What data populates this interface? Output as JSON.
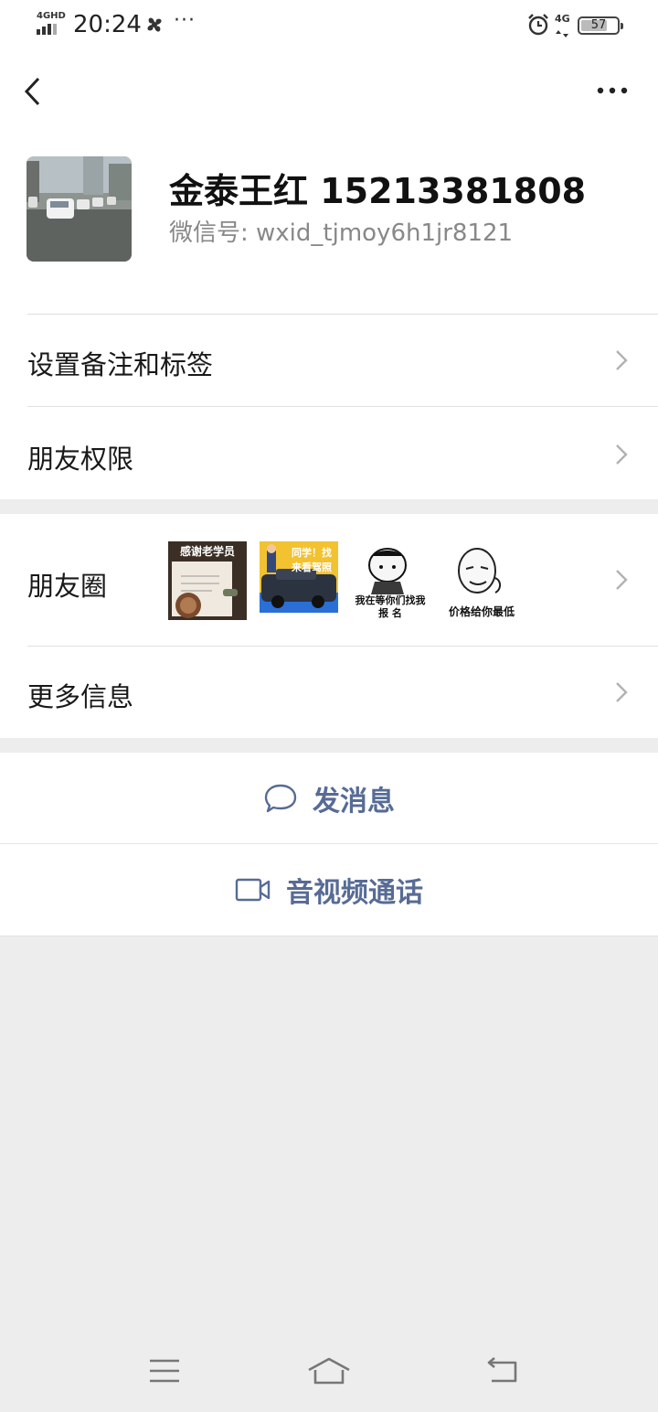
{
  "status_bar": {
    "network_label": "4GHD",
    "time": "20:24",
    "more_dots": "···",
    "mobile_label": "4G",
    "battery_level": "57"
  },
  "profile": {
    "name": "金泰王红 15213381808",
    "wechat_id": "微信号:  wxid_tjmoy6h1jr8121"
  },
  "menu": {
    "remark_tags": "设置备注和标签",
    "friend_permissions": "朋友权限",
    "moments": "朋友圈",
    "more_info": "更多信息"
  },
  "moments_thumbnails": [
    {
      "caption": "感谢老学员"
    },
    {
      "caption": "同学！找来看驾照"
    },
    {
      "caption": "我在等你们找我报    名"
    },
    {
      "caption": "价格给你最低"
    }
  ],
  "actions": {
    "send_message": "发消息",
    "video_call": "音视频通话"
  },
  "colors": {
    "link_blue": "#576b95",
    "page_bg": "#ededed",
    "card_bg": "#ffffff"
  },
  "icons": [
    "back-arrow-icon",
    "more-icon",
    "chevron-right-icon",
    "chat-bubble-icon",
    "video-camera-icon",
    "menu-lines-icon",
    "home-icon",
    "return-icon"
  ]
}
